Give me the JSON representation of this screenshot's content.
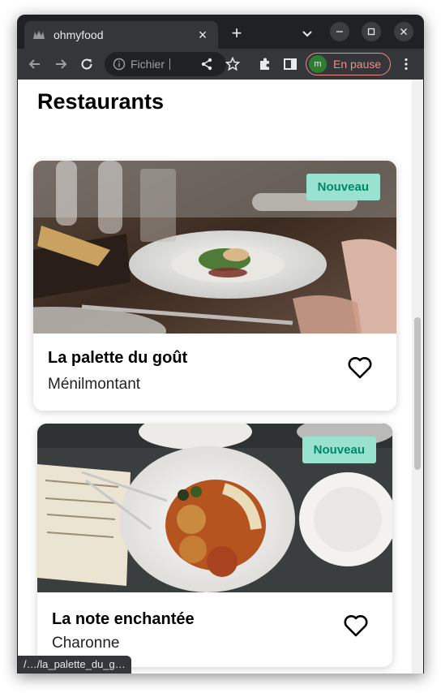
{
  "browser": {
    "tab": {
      "title": "ohmyfood"
    },
    "omnibox": {
      "text": "Fichier"
    },
    "profile": {
      "initial": "m",
      "status": "En pause",
      "color": "#f28b82"
    },
    "status_url": "/…/la_palette_du_g…"
  },
  "page": {
    "title": "Restaurants",
    "restaurants": [
      {
        "name": "La palette du goût",
        "location": "Ménilmontant",
        "badge": "Nouveau",
        "favorite_icon": "heart-outline-icon"
      },
      {
        "name": "La note enchantée",
        "location": "Charonne",
        "badge": "Nouveau",
        "favorite_icon": "heart-outline-icon"
      }
    ]
  },
  "colors": {
    "badge_bg": "#99e2d0",
    "badge_text": "#008766",
    "browser_frame": "#202124",
    "toolbar": "#35363a"
  }
}
